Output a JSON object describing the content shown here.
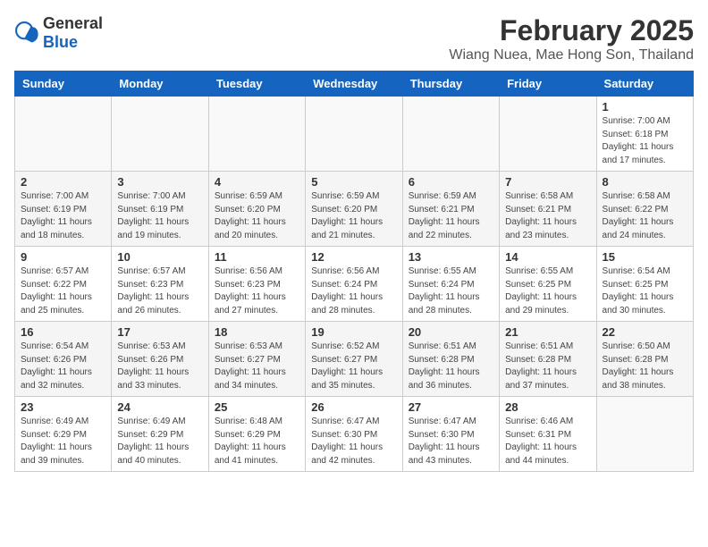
{
  "logo": {
    "general": "General",
    "blue": "Blue"
  },
  "title": "February 2025",
  "subtitle": "Wiang Nuea, Mae Hong Son, Thailand",
  "days_of_week": [
    "Sunday",
    "Monday",
    "Tuesday",
    "Wednesday",
    "Thursday",
    "Friday",
    "Saturday"
  ],
  "weeks": [
    {
      "shaded": false,
      "days": [
        {
          "num": "",
          "info": ""
        },
        {
          "num": "",
          "info": ""
        },
        {
          "num": "",
          "info": ""
        },
        {
          "num": "",
          "info": ""
        },
        {
          "num": "",
          "info": ""
        },
        {
          "num": "",
          "info": ""
        },
        {
          "num": "1",
          "info": "Sunrise: 7:00 AM\nSunset: 6:18 PM\nDaylight: 11 hours\nand 17 minutes."
        }
      ]
    },
    {
      "shaded": true,
      "days": [
        {
          "num": "2",
          "info": "Sunrise: 7:00 AM\nSunset: 6:19 PM\nDaylight: 11 hours\nand 18 minutes."
        },
        {
          "num": "3",
          "info": "Sunrise: 7:00 AM\nSunset: 6:19 PM\nDaylight: 11 hours\nand 19 minutes."
        },
        {
          "num": "4",
          "info": "Sunrise: 6:59 AM\nSunset: 6:20 PM\nDaylight: 11 hours\nand 20 minutes."
        },
        {
          "num": "5",
          "info": "Sunrise: 6:59 AM\nSunset: 6:20 PM\nDaylight: 11 hours\nand 21 minutes."
        },
        {
          "num": "6",
          "info": "Sunrise: 6:59 AM\nSunset: 6:21 PM\nDaylight: 11 hours\nand 22 minutes."
        },
        {
          "num": "7",
          "info": "Sunrise: 6:58 AM\nSunset: 6:21 PM\nDaylight: 11 hours\nand 23 minutes."
        },
        {
          "num": "8",
          "info": "Sunrise: 6:58 AM\nSunset: 6:22 PM\nDaylight: 11 hours\nand 24 minutes."
        }
      ]
    },
    {
      "shaded": false,
      "days": [
        {
          "num": "9",
          "info": "Sunrise: 6:57 AM\nSunset: 6:22 PM\nDaylight: 11 hours\nand 25 minutes."
        },
        {
          "num": "10",
          "info": "Sunrise: 6:57 AM\nSunset: 6:23 PM\nDaylight: 11 hours\nand 26 minutes."
        },
        {
          "num": "11",
          "info": "Sunrise: 6:56 AM\nSunset: 6:23 PM\nDaylight: 11 hours\nand 27 minutes."
        },
        {
          "num": "12",
          "info": "Sunrise: 6:56 AM\nSunset: 6:24 PM\nDaylight: 11 hours\nand 28 minutes."
        },
        {
          "num": "13",
          "info": "Sunrise: 6:55 AM\nSunset: 6:24 PM\nDaylight: 11 hours\nand 28 minutes."
        },
        {
          "num": "14",
          "info": "Sunrise: 6:55 AM\nSunset: 6:25 PM\nDaylight: 11 hours\nand 29 minutes."
        },
        {
          "num": "15",
          "info": "Sunrise: 6:54 AM\nSunset: 6:25 PM\nDaylight: 11 hours\nand 30 minutes."
        }
      ]
    },
    {
      "shaded": true,
      "days": [
        {
          "num": "16",
          "info": "Sunrise: 6:54 AM\nSunset: 6:26 PM\nDaylight: 11 hours\nand 32 minutes."
        },
        {
          "num": "17",
          "info": "Sunrise: 6:53 AM\nSunset: 6:26 PM\nDaylight: 11 hours\nand 33 minutes."
        },
        {
          "num": "18",
          "info": "Sunrise: 6:53 AM\nSunset: 6:27 PM\nDaylight: 11 hours\nand 34 minutes."
        },
        {
          "num": "19",
          "info": "Sunrise: 6:52 AM\nSunset: 6:27 PM\nDaylight: 11 hours\nand 35 minutes."
        },
        {
          "num": "20",
          "info": "Sunrise: 6:51 AM\nSunset: 6:28 PM\nDaylight: 11 hours\nand 36 minutes."
        },
        {
          "num": "21",
          "info": "Sunrise: 6:51 AM\nSunset: 6:28 PM\nDaylight: 11 hours\nand 37 minutes."
        },
        {
          "num": "22",
          "info": "Sunrise: 6:50 AM\nSunset: 6:28 PM\nDaylight: 11 hours\nand 38 minutes."
        }
      ]
    },
    {
      "shaded": false,
      "days": [
        {
          "num": "23",
          "info": "Sunrise: 6:49 AM\nSunset: 6:29 PM\nDaylight: 11 hours\nand 39 minutes."
        },
        {
          "num": "24",
          "info": "Sunrise: 6:49 AM\nSunset: 6:29 PM\nDaylight: 11 hours\nand 40 minutes."
        },
        {
          "num": "25",
          "info": "Sunrise: 6:48 AM\nSunset: 6:29 PM\nDaylight: 11 hours\nand 41 minutes."
        },
        {
          "num": "26",
          "info": "Sunrise: 6:47 AM\nSunset: 6:30 PM\nDaylight: 11 hours\nand 42 minutes."
        },
        {
          "num": "27",
          "info": "Sunrise: 6:47 AM\nSunset: 6:30 PM\nDaylight: 11 hours\nand 43 minutes."
        },
        {
          "num": "28",
          "info": "Sunrise: 6:46 AM\nSunset: 6:31 PM\nDaylight: 11 hours\nand 44 minutes."
        },
        {
          "num": "",
          "info": ""
        }
      ]
    }
  ]
}
